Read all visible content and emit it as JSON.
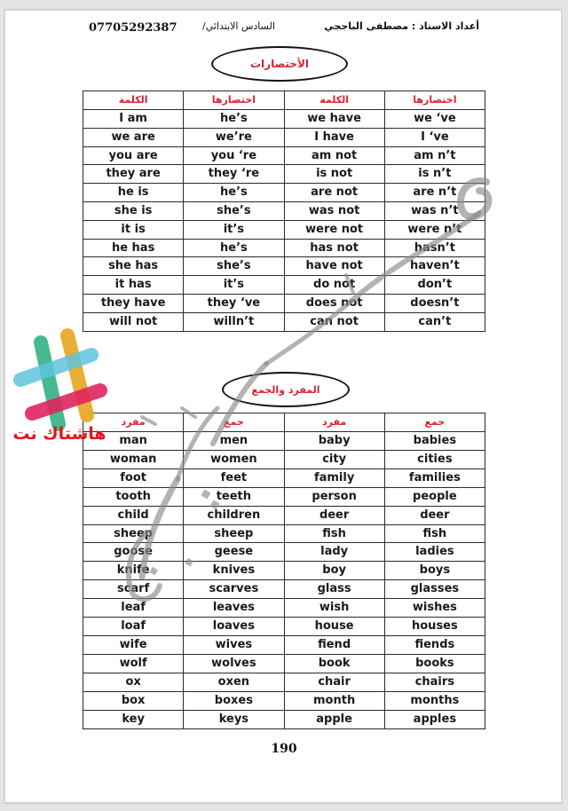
{
  "header": {
    "phone": "07705292387",
    "grade": "السادس الابتدائي/",
    "author": "أعداد الاستاذ : مصطفى الباججي"
  },
  "section1": {
    "title": "الأختصارات",
    "headers": [
      "الكلمة",
      "اختصارها",
      "الكلمة",
      "اختصارها"
    ],
    "rows": [
      [
        "I am",
        "he’s",
        "we have",
        "we ‘ve"
      ],
      [
        "we are",
        "we’re",
        "I have",
        "I ‘ve"
      ],
      [
        "you are",
        "you ‘re",
        "am not",
        "am n’t"
      ],
      [
        "they are",
        "they ‘re",
        "is not",
        "is n’t"
      ],
      [
        "he is",
        "he’s",
        "are not",
        "are n’t"
      ],
      [
        "she is",
        "she’s",
        "was not",
        "was n’t"
      ],
      [
        "it is",
        "it’s",
        "were not",
        "were n’t"
      ],
      [
        "he has",
        "he’s",
        "has not",
        "hasn’t"
      ],
      [
        "she has",
        "she’s",
        "have not",
        "haven’t"
      ],
      [
        "it has",
        "it’s",
        "do not",
        "don’t"
      ],
      [
        "they have",
        "they ‘ve",
        "does not",
        "doesn’t"
      ],
      [
        "will not",
        "willn’t",
        "can not",
        "can’t"
      ]
    ]
  },
  "section2": {
    "title": "المفرد والجمع",
    "headers": [
      "مفرد",
      "جمع",
      "مفرد",
      "جمع"
    ],
    "rows": [
      [
        "man",
        "men",
        "baby",
        "babies"
      ],
      [
        "woman",
        "women",
        "city",
        "cities"
      ],
      [
        "foot",
        "feet",
        "family",
        "families"
      ],
      [
        "tooth",
        "teeth",
        "person",
        "people"
      ],
      [
        "child",
        "children",
        "deer",
        "deer"
      ],
      [
        "sheep",
        "sheep",
        "fish",
        "fish"
      ],
      [
        "goose",
        "geese",
        "lady",
        "ladies"
      ],
      [
        "knife",
        "knives",
        "boy",
        "boys"
      ],
      [
        "scarf",
        "scarves",
        "glass",
        "glasses"
      ],
      [
        "leaf",
        "leaves",
        "wish",
        "wishes"
      ],
      [
        "loaf",
        "loaves",
        "house",
        "houses"
      ],
      [
        "wife",
        "wives",
        "fiend",
        "fiends"
      ],
      [
        "wolf",
        "wolves",
        "book",
        "books"
      ],
      [
        "ox",
        "oxen",
        "chair",
        "chairs"
      ],
      [
        "box",
        "boxes",
        "month",
        "months"
      ],
      [
        "key",
        "keys",
        "apple",
        "apples"
      ]
    ]
  },
  "page_number": "190",
  "logo": {
    "text": "هاشتاك نت",
    "icon": "hashtag-logo-icon"
  },
  "colors": {
    "heading_red": "#d9232d",
    "logo_red": "#e3141b",
    "watermark_gray": "#8a8a8a"
  }
}
